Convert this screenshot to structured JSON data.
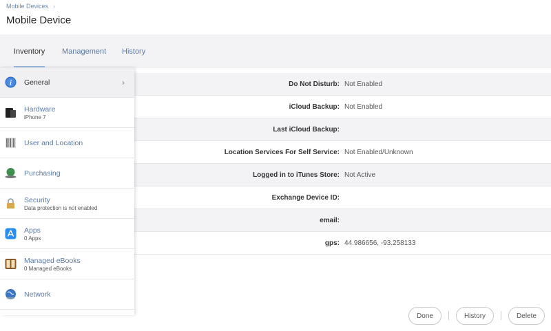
{
  "breadcrumb": {
    "parent": "Mobile Devices"
  },
  "page_title": "Mobile Device",
  "tabs": [
    {
      "label": "Inventory",
      "active": true
    },
    {
      "label": "Management"
    },
    {
      "label": "History"
    }
  ],
  "sidebar": {
    "items": [
      {
        "name": "General",
        "sub": "",
        "icon": "info-icon",
        "active": true
      },
      {
        "name": "Hardware",
        "sub": "iPhone 7",
        "icon": "device-icon"
      },
      {
        "name": "User and Location",
        "sub": "",
        "icon": "user-location-icon"
      },
      {
        "name": "Purchasing",
        "sub": "",
        "icon": "purchasing-icon"
      },
      {
        "name": "Security",
        "sub": "Data protection is not enabled",
        "icon": "lock-icon"
      },
      {
        "name": "Apps",
        "sub": "0 Apps",
        "icon": "app-store-icon"
      },
      {
        "name": "Managed eBooks",
        "sub": "0 Managed eBooks",
        "icon": "book-icon"
      },
      {
        "name": "Network",
        "sub": "",
        "icon": "globe-icon"
      }
    ]
  },
  "details": [
    {
      "label": "Do Not Disturb:",
      "value": "Not Enabled"
    },
    {
      "label": "iCloud Backup:",
      "value": "Not Enabled"
    },
    {
      "label": "Last iCloud Backup:",
      "value": ""
    },
    {
      "label": "Location Services For Self Service:",
      "value": "Not Enabled/Unknown"
    },
    {
      "label": "Logged in to iTunes Store:",
      "value": "Not Active"
    },
    {
      "label": "Exchange Device ID:",
      "value": ""
    },
    {
      "label": "email:",
      "value": ""
    },
    {
      "label": "gps:",
      "value": "44.986656, -93.258133"
    }
  ],
  "footer": {
    "done": "Done",
    "history": "History",
    "delete": "Delete"
  }
}
